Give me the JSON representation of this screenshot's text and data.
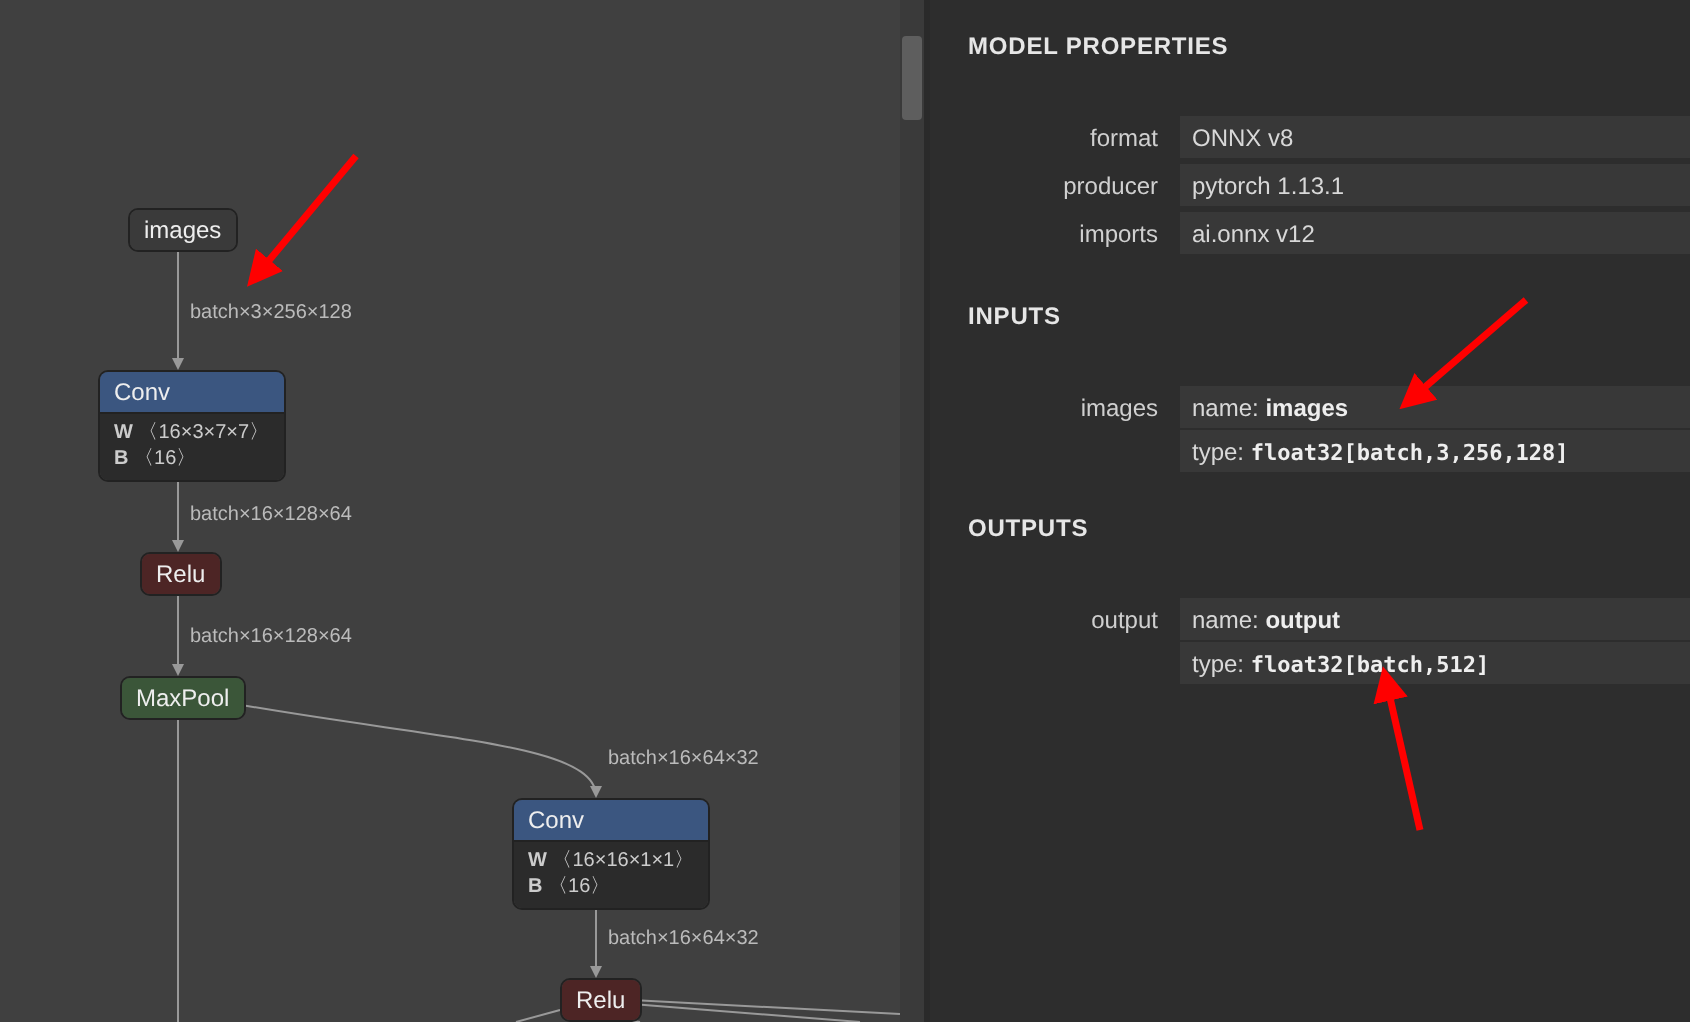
{
  "graph": {
    "nodes": [
      {
        "kind": "input",
        "label": "images"
      },
      {
        "kind": "layer",
        "label": "Conv",
        "attributes": [
          {
            "name": "W",
            "shape": "〈16×3×7×7〉"
          },
          {
            "name": "B",
            "shape": "〈16〉"
          }
        ]
      },
      {
        "kind": "activation",
        "label": "Relu"
      },
      {
        "kind": "pool",
        "label": "MaxPool"
      },
      {
        "kind": "layer",
        "label": "Conv",
        "attributes": [
          {
            "name": "W",
            "shape": "〈16×16×1×1〉"
          },
          {
            "name": "B",
            "shape": "〈16〉"
          }
        ]
      },
      {
        "kind": "activation",
        "label": "Relu"
      }
    ],
    "edge_labels": [
      "batch×3×256×128",
      "batch×16×128×64",
      "batch×16×128×64",
      "batch×16×64×32",
      "batch×16×64×32"
    ]
  },
  "properties": {
    "title": "MODEL PROPERTIES",
    "model": [
      {
        "label": "format",
        "value": "ONNX v8"
      },
      {
        "label": "producer",
        "value": "pytorch 1.13.1"
      },
      {
        "label": "imports",
        "value": "ai.onnx v12"
      }
    ],
    "inputs_title": "INPUTS",
    "inputs": [
      {
        "label": "images",
        "name_label": "name:",
        "name": "images",
        "type_label": "type:",
        "type": "float32[batch,3,256,128]"
      }
    ],
    "outputs_title": "OUTPUTS",
    "outputs": [
      {
        "label": "output",
        "name_label": "name:",
        "name": "output",
        "type_label": "type:",
        "type": "float32[batch,512]"
      }
    ]
  }
}
